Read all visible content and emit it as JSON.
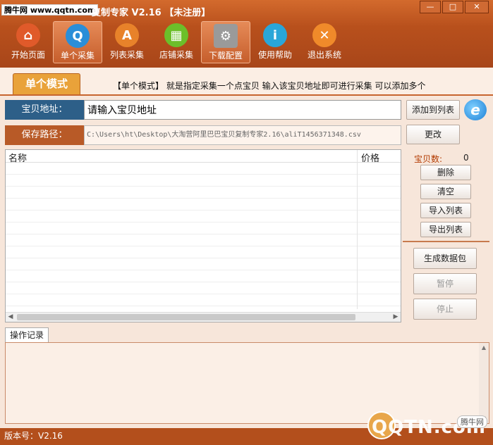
{
  "watermark": "腾牛网 www.qqtn.com",
  "app": {
    "title": "复制专家 V2.16 【未注册】"
  },
  "window_controls": {
    "minimize": "—",
    "maximize": "□",
    "close": "✕"
  },
  "toolbar": [
    {
      "label": "开始页面",
      "icon": "home-icon",
      "color": "#e05a2a"
    },
    {
      "label": "单个采集",
      "icon": "search-icon",
      "color": "#2a8ed8",
      "active": true
    },
    {
      "label": "列表采集",
      "icon": "list-icon",
      "color": "#e8822a"
    },
    {
      "label": "店铺采集",
      "icon": "shop-icon",
      "color": "#6cbf2a"
    },
    {
      "label": "下载配置",
      "icon": "settings-icon",
      "color": "#9a9a9a",
      "active": true
    },
    {
      "label": "使用帮助",
      "icon": "info-icon",
      "color": "#2aa6d8"
    },
    {
      "label": "退出系统",
      "icon": "close-icon",
      "color": "#f08a2a"
    }
  ],
  "mode": {
    "tab_label": "单个模式",
    "description": "【单个模式】 就是指定采集一个点宝贝  输入该宝贝地址即可进行采集  可以添加多个"
  },
  "address": {
    "label": "宝贝地址：",
    "placeholder": "请输入宝贝地址",
    "add_button": "添加到列表"
  },
  "save": {
    "label": "保存路径：",
    "path": "C:\\Users\\ht\\Desktop\\大淘营阿里巴巴宝贝复制专家2.16\\aliT1456371348.csv",
    "change_button": "更改"
  },
  "table": {
    "columns": [
      "名称",
      "价格"
    ],
    "rows": []
  },
  "side": {
    "count_label": "宝贝数:",
    "count_value": "0",
    "delete": "删除",
    "clear": "清空",
    "import": "导入列表",
    "export": "导出列表",
    "generate": "生成数据包",
    "pause": "暂停",
    "stop": "停止"
  },
  "log": {
    "tab": "操作记录"
  },
  "status": {
    "version": "版本号：V2.16"
  },
  "brand": {
    "text": "QQTN.com",
    "badge": "腾牛网"
  }
}
